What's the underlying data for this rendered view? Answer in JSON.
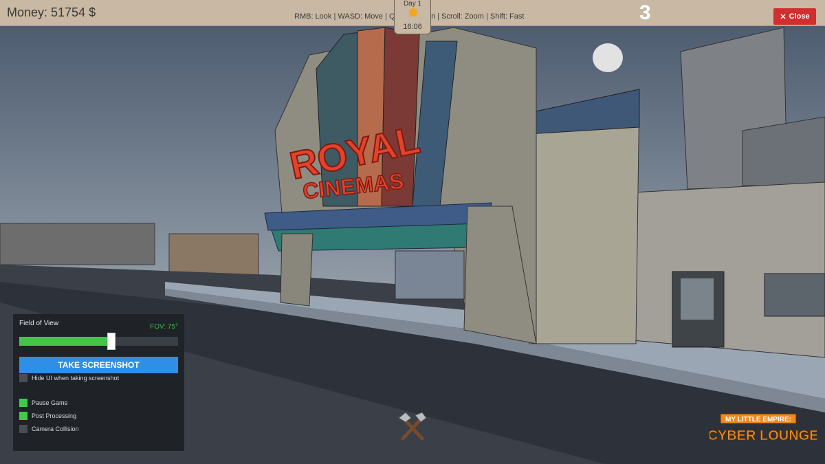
{
  "topbar": {
    "money": "Money: 51754 $",
    "controls_hint": "RMB: Look | WASD: Move | QE: Up/Down | Scroll: Zoom | Shift: Fast",
    "clock": {
      "day": "Day 1",
      "time": "16:06"
    },
    "speed": "3",
    "close_label": "Close",
    "close_icon": "✕"
  },
  "scene": {
    "marquee_line1": "ROYAL",
    "marquee_line2": "CINEMAS"
  },
  "camera_panel": {
    "title": "Field of View",
    "fov_readout": "FOV: 75°",
    "fov_fraction": 0.58,
    "screenshot_button": "TAKE SCREENSHOT",
    "options": [
      {
        "label": "Hide UI when taking screenshot",
        "checked": false
      },
      {
        "label": "Pause Game",
        "checked": true
      },
      {
        "label": "Post Processing",
        "checked": true
      },
      {
        "label": "Camera Collision",
        "checked": false
      }
    ]
  },
  "logo": {
    "line1": "MY LITTLE EMPIRE:",
    "line2": "CYBER LOUNGE"
  },
  "colors": {
    "topbar": "#c8b8a4",
    "panel": "#1f2328",
    "accent_blue": "#2f8fe6",
    "accent_green": "#3fcb4a",
    "close_red": "#d12f2f",
    "logo_orange": "#f08a1c"
  },
  "icons": [
    "sun-icon",
    "close-icon",
    "hammer-wrench-icon"
  ]
}
